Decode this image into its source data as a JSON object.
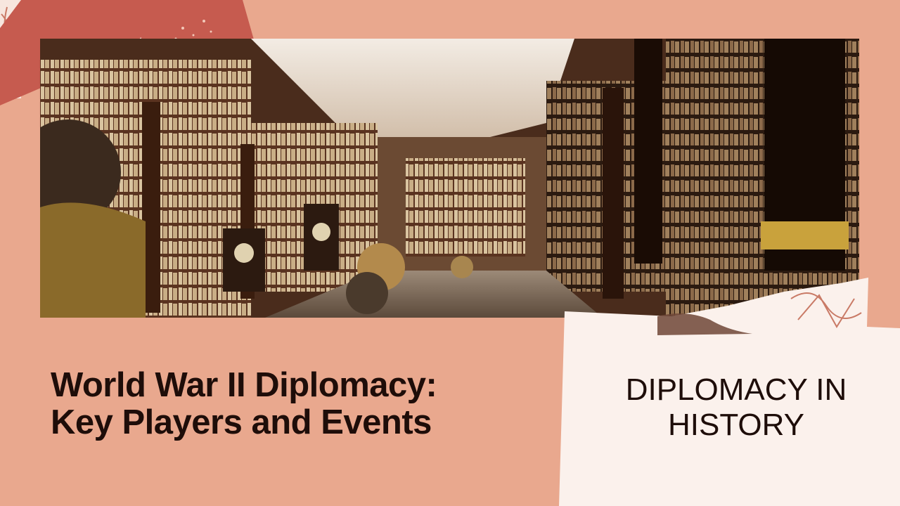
{
  "slide": {
    "title_lines": [
      "World War II Diplomacy:",
      "Key Players and Events"
    ],
    "tag_lines": [
      "DIPLOMACY IN",
      "HISTORY"
    ]
  },
  "photo": {
    "subject": "baroque library hall with bookshelves, twisted columns, globes and painted ceiling"
  },
  "colors": {
    "background": "#e9a88e",
    "accent_red": "#c65b4f",
    "paper": "#fbf1ec",
    "text": "#1e0d09"
  }
}
